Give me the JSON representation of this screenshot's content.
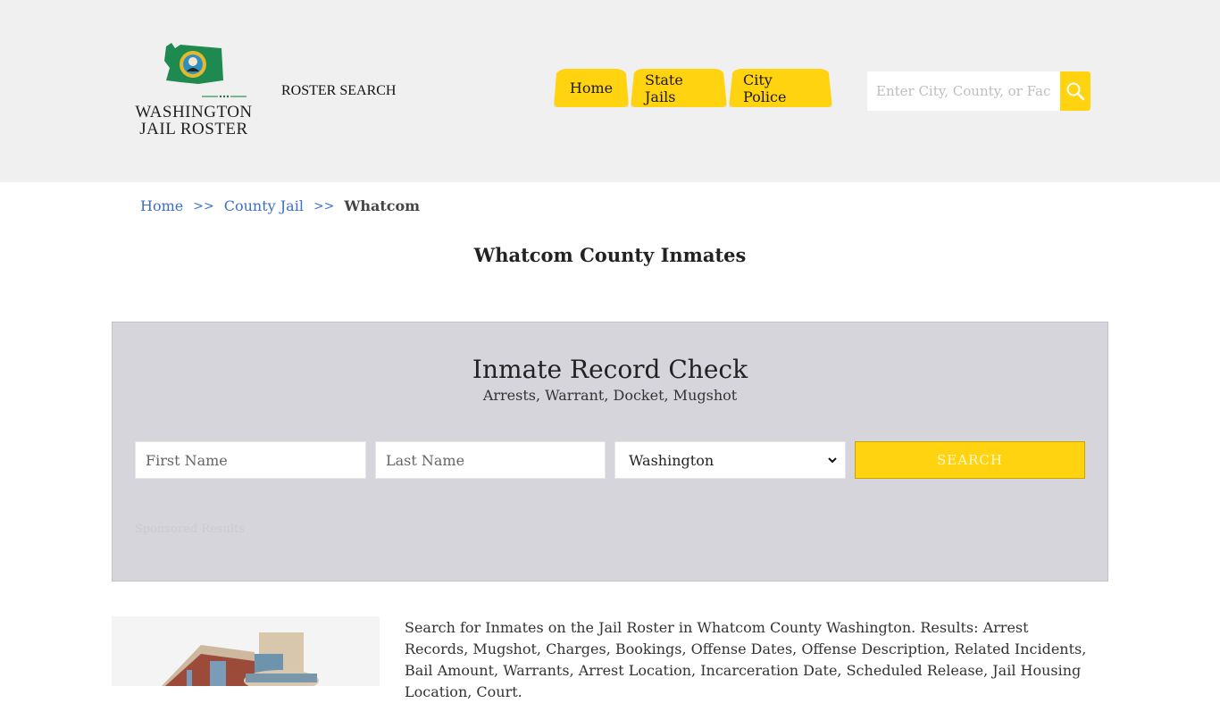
{
  "header": {
    "logo_line1": "WASHINGTON",
    "logo_line2": "JAIL ROSTER",
    "roster_search": "ROSTER SEARCH",
    "nav": [
      {
        "label": "Home"
      },
      {
        "label": "State Jails"
      },
      {
        "label": "City Police"
      }
    ],
    "search": {
      "placeholder": "Enter City, County, or Facility",
      "value": ""
    }
  },
  "breadcrumb": {
    "items": [
      "Home",
      "County Jail"
    ],
    "separator": ">>",
    "current": "Whatcom"
  },
  "page_title": "Whatcom County Inmates",
  "record_check": {
    "title": "Inmate Record Check",
    "subtitle": "Arrests, Warrant, Docket, Mugshot",
    "first_name_placeholder": "First Name",
    "last_name_placeholder": "Last Name",
    "state_selected": "Washington",
    "search_label": "SEARCH",
    "sponsored": "Sponsored Results"
  },
  "description": "Search for Inmates on the Jail Roster in Whatcom County Washington. Results: Arrest Records, Mugshot, Charges, Bookings, Offense Dates, Offense Description, Related Incidents, Bail Amount, Warrants, Arrest Location, Incarceration Date, Scheduled Release, Jail Housing Location, Court.",
  "colors": {
    "accent_yellow": "#ffd30f",
    "link_blue": "#3c6fc8",
    "header_bg": "#f0f0f0",
    "record_box_bg": "#d5d5db"
  }
}
